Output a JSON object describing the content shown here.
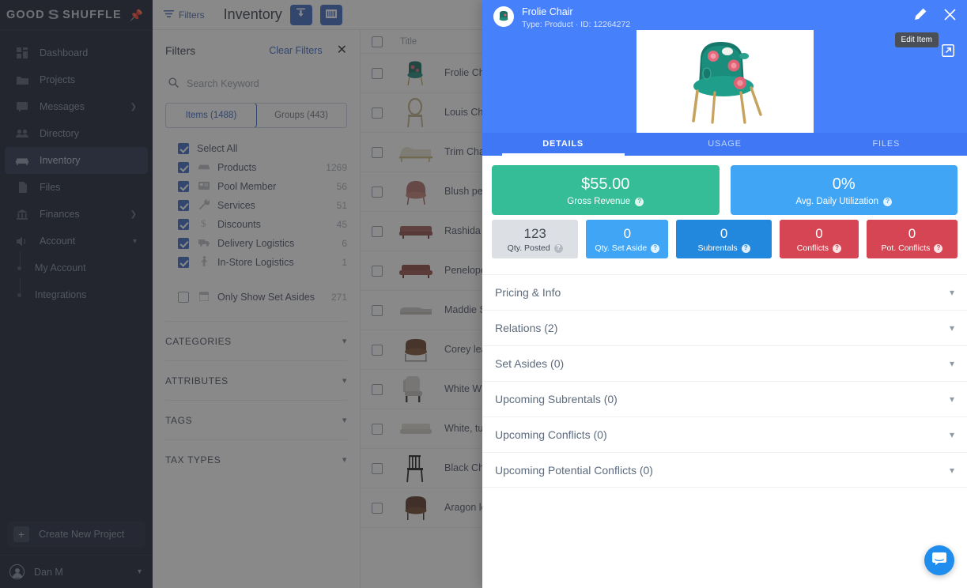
{
  "brand": {
    "name_left": "GOOD",
    "name_right": "SHUFFLE",
    "logo_glyph": "S",
    "pin_icon": "pin-icon"
  },
  "sidebar": {
    "items": [
      {
        "label": "Dashboard",
        "icon": "dashboard-icon",
        "has_chevron": false,
        "active": false
      },
      {
        "label": "Projects",
        "icon": "projects-icon",
        "has_chevron": false,
        "active": false
      },
      {
        "label": "Messages",
        "icon": "messages-icon",
        "has_chevron": true,
        "active": false
      },
      {
        "label": "Directory",
        "icon": "directory-icon",
        "has_chevron": false,
        "active": false
      },
      {
        "label": "Inventory",
        "icon": "inventory-icon",
        "has_chevron": false,
        "active": true
      },
      {
        "label": "Files",
        "icon": "files-icon",
        "has_chevron": false,
        "active": false
      },
      {
        "label": "Finances",
        "icon": "finances-icon",
        "has_chevron": true,
        "active": false
      },
      {
        "label": "Account",
        "icon": "account-icon",
        "has_chevron": true,
        "active": false
      }
    ],
    "sub_items": [
      {
        "label": "My Account"
      },
      {
        "label": "Integrations"
      }
    ],
    "create_button": "Create New Project",
    "user": {
      "name": "Dan M"
    }
  },
  "topbar": {
    "filters_label": "Filters",
    "page_title": "Inventory",
    "buttons": [
      {
        "name": "import-button",
        "icon": "upload-icon"
      },
      {
        "name": "scan-button",
        "icon": "barcode-icon"
      }
    ]
  },
  "filters": {
    "title": "Filters",
    "clear_label": "Clear Filters",
    "close_icon": "close-icon",
    "search_placeholder": "Search Keyword",
    "search_value": "",
    "segments": [
      {
        "label": "Items (1488)",
        "selected": true
      },
      {
        "label": "Groups (443)",
        "selected": false
      }
    ],
    "checkboxes": [
      {
        "label": "Select All",
        "count": "",
        "checked": true,
        "icon": ""
      },
      {
        "label": "Products",
        "count": "1269",
        "checked": true,
        "icon": "product-icon"
      },
      {
        "label": "Pool Member",
        "count": "56",
        "checked": true,
        "icon": "pool-icon"
      },
      {
        "label": "Services",
        "count": "51",
        "checked": true,
        "icon": "wrench-icon"
      },
      {
        "label": "Discounts",
        "count": "45",
        "checked": true,
        "icon": "discount-icon"
      },
      {
        "label": "Delivery Logistics",
        "count": "6",
        "checked": true,
        "icon": "truck-icon"
      },
      {
        "label": "In-Store Logistics",
        "count": "1",
        "checked": true,
        "icon": "person-icon"
      }
    ],
    "set_asides": {
      "label": "Only Show Set Asides",
      "count": "271",
      "checked": false,
      "icon": "calendar-icon"
    },
    "sections": [
      {
        "label": "CATEGORIES"
      },
      {
        "label": "ATTRIBUTES"
      },
      {
        "label": "TAGS"
      },
      {
        "label": "TAX TYPES"
      }
    ]
  },
  "list": {
    "header_title": "Title",
    "rows": [
      {
        "title": "Frolie Chair",
        "thumb": "teal-floral-chair"
      },
      {
        "title": "Louis Chair",
        "thumb": "louis-chair"
      },
      {
        "title": "Trim Chaise Gold",
        "thumb": "chaise"
      },
      {
        "title": "Blush petal armchair velvet",
        "thumb": "blush-armchair"
      },
      {
        "title": "Rashida Sofa (Red)",
        "thumb": "red-sofa"
      },
      {
        "title": "Penelope Pink Sofa",
        "thumb": "pink-sofa"
      },
      {
        "title": "Maddie Sectional",
        "thumb": "sectional"
      },
      {
        "title": "Corey leather armchair (Brown)",
        "thumb": "brown-leather-armchair"
      },
      {
        "title": "White Wingback Chair",
        "thumb": "white-wingback"
      },
      {
        "title": "White, tufted couch scroll arms",
        "thumb": "white-tufted-couch"
      },
      {
        "title": "Black Chiavari Chair",
        "thumb": "chiavari-chair"
      },
      {
        "title": "Aragon leather chair (Brown)",
        "thumb": "aragon-chair"
      }
    ]
  },
  "drawer": {
    "item_name": "Frolie Chair",
    "item_meta": "Type: Product · ID: 12264272",
    "edit_icon": "pencil-icon",
    "close_icon": "close-icon",
    "external_icon": "external-link-icon",
    "tooltip": "Edit Item",
    "image_alt": "teal-floral-chair",
    "tabs": [
      {
        "label": "DETAILS",
        "active": true
      },
      {
        "label": "USAGE",
        "active": false
      },
      {
        "label": "FILES",
        "active": false
      }
    ],
    "kpis_large": [
      {
        "value": "$55.00",
        "label": "Gross Revenue",
        "color": "#34bd96",
        "help": true
      },
      {
        "value": "0%",
        "label": "Avg. Daily Utilization",
        "color": "#41a5f5",
        "help": true
      }
    ],
    "kpis_small": [
      {
        "value": "123",
        "label": "Qty. Posted",
        "bg": "#dcdfe3",
        "fg": "#444b57",
        "help": true,
        "flex": 1.16
      },
      {
        "value": "0",
        "label": "Qty. Set Aside",
        "bg": "#41a5f5",
        "fg": "#ffffff",
        "help": true,
        "flex": 1.1
      },
      {
        "value": "0",
        "label": "Subrentals",
        "bg": "#2288dd",
        "fg": "#ffffff",
        "help": true,
        "flex": 1.28
      },
      {
        "value": "0",
        "label": "Conflicts",
        "bg": "#d64553",
        "fg": "#ffffff",
        "help": true,
        "flex": 1.06
      },
      {
        "value": "0",
        "label": "Pot. Conflicts",
        "bg": "#d64553",
        "fg": "#ffffff",
        "help": true,
        "flex": 1.22
      }
    ],
    "sections": [
      {
        "label": "Pricing & Info"
      },
      {
        "label": "Relations (2)"
      },
      {
        "label": "Set Asides (0)"
      },
      {
        "label": "Upcoming Subrentals (0)"
      },
      {
        "label": "Upcoming Conflicts (0)"
      },
      {
        "label": "Upcoming Potential Conflicts (0)"
      }
    ]
  },
  "intercom": {
    "icon": "chat-bubble-icon"
  },
  "colors": {
    "drawer_header": "#4680fa",
    "tab_bar": "#3f77f4",
    "sidebar_bg": "#1d2436",
    "accent_blue": "#3e6bc4",
    "green": "#34bd96",
    "light_blue": "#41a5f5",
    "dark_blue": "#2288dd",
    "red": "#d64553"
  }
}
